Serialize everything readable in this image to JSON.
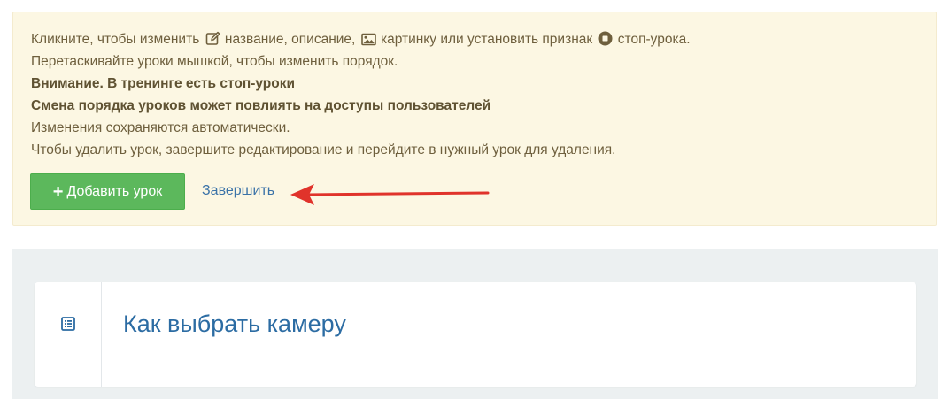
{
  "notice": {
    "line1_part1": "Кликните, чтобы изменить",
    "line1_part2": "название, описание,",
    "line1_part3": "картинку или установить признак",
    "line1_part4": "стоп-урока.",
    "line2": "Перетаскивайте уроки мышкой, чтобы изменить порядок.",
    "line3": "Внимание. В тренинге есть стоп-уроки",
    "line4": "Смена порядка уроков может повлиять на доступы пользователей",
    "line5": "Изменения сохраняются автоматически.",
    "line6": "Чтобы удалить урок, завершите редактирование и перейдите в нужный урок для удаления."
  },
  "actions": {
    "add_lesson_label": "Добавить урок",
    "finish_label": "Завершить"
  },
  "lessons": [
    {
      "title": "Как выбрать камеру",
      "icon": "list-icon"
    }
  ],
  "colors": {
    "notice_bg": "#fcf7e3",
    "notice_text": "#6e5f3d",
    "add_button": "#5cb85c",
    "link": "#3b73a8",
    "arrow": "#e0332b",
    "panel_bg": "#ecf0f1",
    "lesson_title": "#2c6ca3"
  },
  "icons": [
    "edit-icon",
    "image-icon",
    "stop-icon",
    "plus-icon",
    "arrow-icon",
    "list-icon"
  ]
}
